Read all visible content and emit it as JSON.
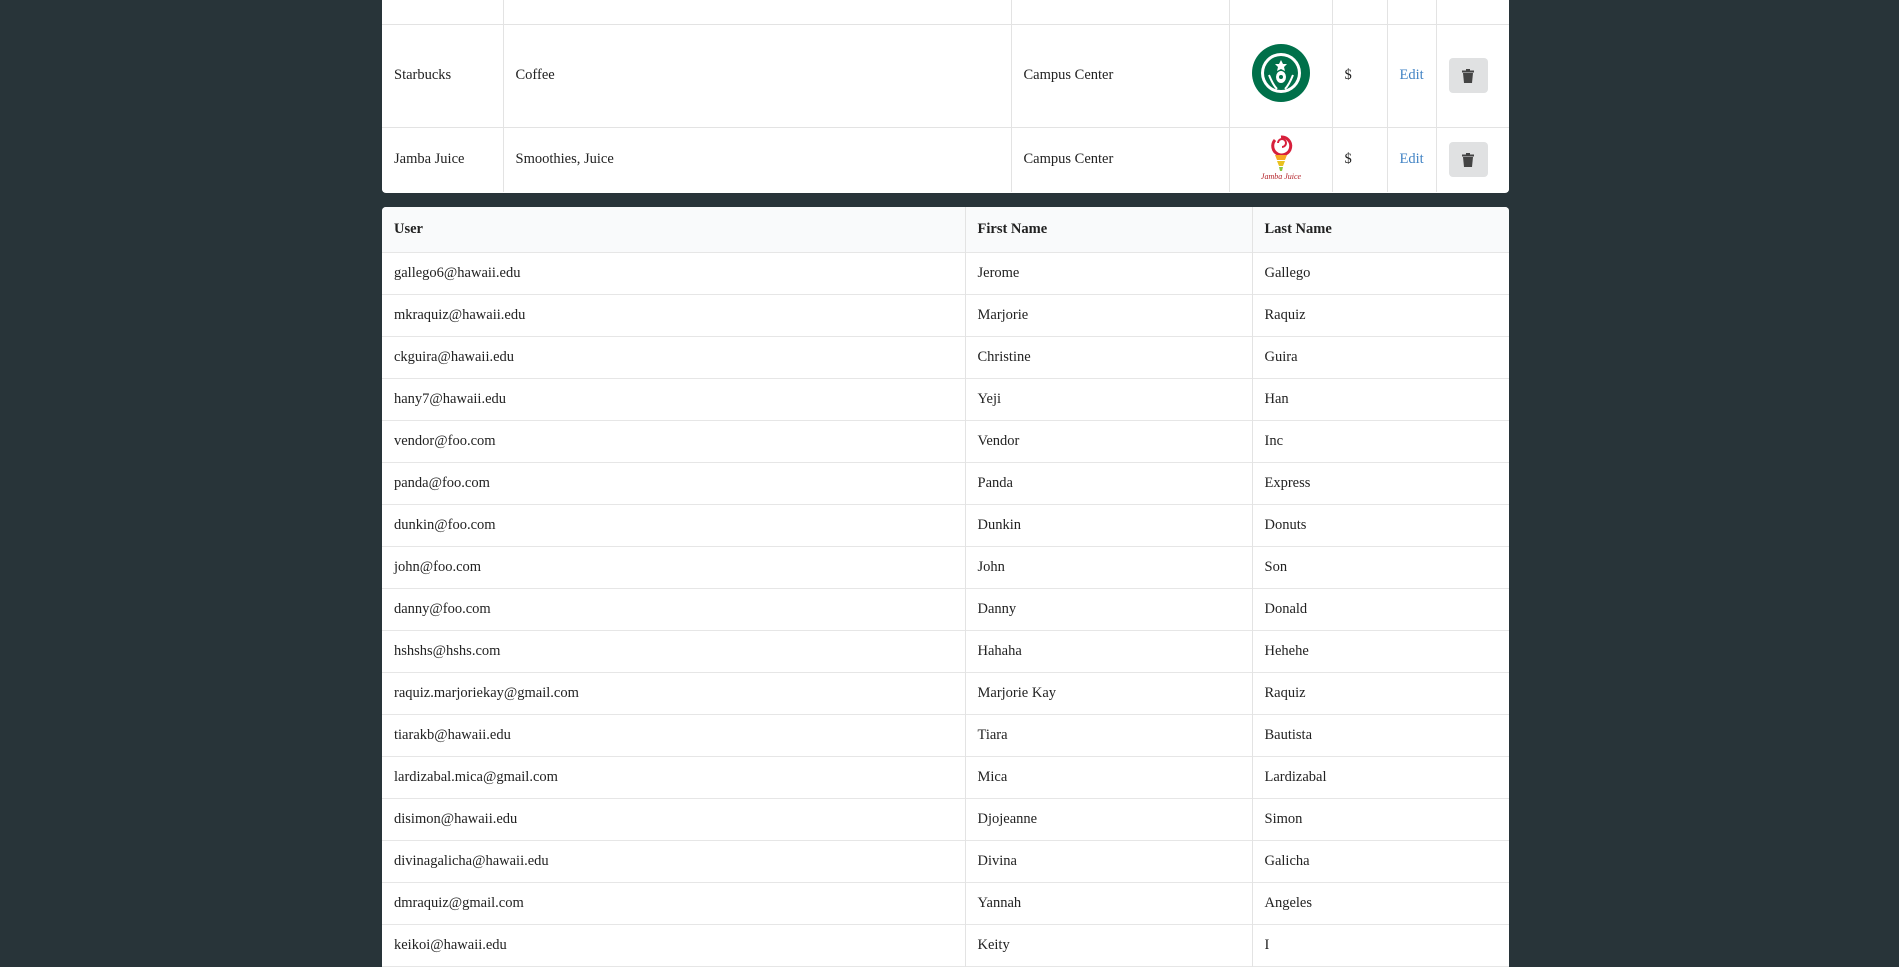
{
  "vendors": {
    "rows": [
      {
        "name": "Starbucks",
        "type": "Coffee",
        "location": "Campus Center",
        "logo": "starbucks-logo",
        "price": "$",
        "edit": "Edit"
      },
      {
        "name": "Jamba Juice",
        "type": "Smoothies, Juice",
        "location": "Campus Center",
        "logo": "jamba-juice-logo",
        "logo_text": "Jamba Juice",
        "price": "$",
        "edit": "Edit"
      }
    ],
    "delete_icon": "trash-icon"
  },
  "users": {
    "headers": {
      "user": "User",
      "first": "First Name",
      "last": "Last Name"
    },
    "rows": [
      {
        "user": "gallego6@hawaii.edu",
        "first": "Jerome",
        "last": "Gallego"
      },
      {
        "user": "mkraquiz@hawaii.edu",
        "first": "Marjorie",
        "last": "Raquiz"
      },
      {
        "user": "ckguira@hawaii.edu",
        "first": "Christine",
        "last": "Guira"
      },
      {
        "user": "hany7@hawaii.edu",
        "first": "Yeji",
        "last": "Han"
      },
      {
        "user": "vendor@foo.com",
        "first": "Vendor",
        "last": "Inc"
      },
      {
        "user": "panda@foo.com",
        "first": "Panda",
        "last": "Express"
      },
      {
        "user": "dunkin@foo.com",
        "first": "Dunkin",
        "last": "Donuts"
      },
      {
        "user": "john@foo.com",
        "first": "John",
        "last": "Son"
      },
      {
        "user": "danny@foo.com",
        "first": "Danny",
        "last": "Donald"
      },
      {
        "user": "hshshs@hshs.com",
        "first": "Hahaha",
        "last": "Hehehe"
      },
      {
        "user": "raquiz.marjoriekay@gmail.com",
        "first": "Marjorie Kay",
        "last": "Raquiz"
      },
      {
        "user": "tiarakb@hawaii.edu",
        "first": "Tiara",
        "last": "Bautista"
      },
      {
        "user": "lardizabal.mica@gmail.com",
        "first": "Mica",
        "last": "Lardizabal"
      },
      {
        "user": "disimon@hawaii.edu",
        "first": "Djojeanne",
        "last": "Simon"
      },
      {
        "user": "divinagalicha@hawaii.edu",
        "first": "Divina",
        "last": "Galicha"
      },
      {
        "user": "dmraquiz@gmail.com",
        "first": "Yannah",
        "last": "Angeles"
      },
      {
        "user": "keikoi@hawaii.edu",
        "first": "Keity",
        "last": "I"
      }
    ]
  }
}
